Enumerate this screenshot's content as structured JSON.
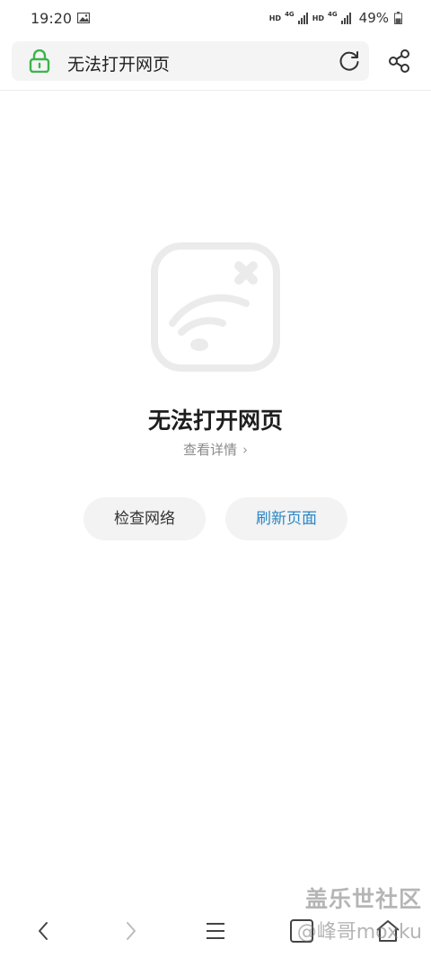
{
  "status_bar": {
    "time": "19:20",
    "net1": "HD",
    "net1_gen": "4G",
    "net2": "HD",
    "net2_gen": "4G",
    "battery": "49%"
  },
  "address_bar": {
    "title": "无法打开网页",
    "lock_color": "#3cb44b"
  },
  "error": {
    "title": "无法打开网页",
    "details_link": "查看详情",
    "details_chevron": "›"
  },
  "actions": {
    "check_network": "检查网络",
    "refresh_page": "刷新页面",
    "refresh_color": "#2b86c5"
  },
  "watermark": {
    "line1": "盖乐世社区",
    "line2": "@峰哥moxku"
  },
  "icons": {
    "status": [
      "gallery-icon",
      "signal-icon",
      "battery-icon"
    ],
    "address": [
      "lock-icon",
      "reload-icon",
      "share-icon"
    ],
    "bottom": [
      "back-icon",
      "forward-icon",
      "menu-icon",
      "tabs-icon",
      "home-icon"
    ]
  }
}
